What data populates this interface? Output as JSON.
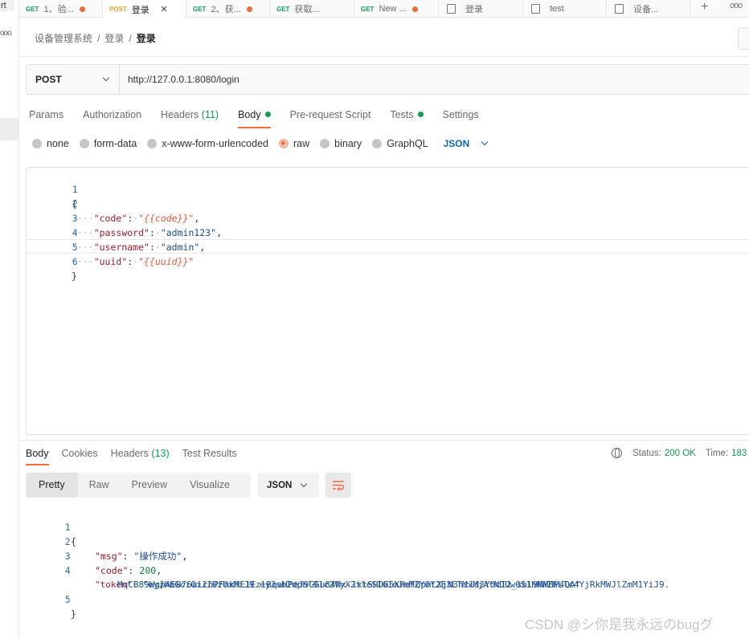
{
  "left_strip": {
    "fragment": "rt",
    "more": "ooo"
  },
  "tabs": [
    {
      "method": "GET",
      "label": "1、验...",
      "dot": true
    },
    {
      "method": "POST",
      "label": "登录",
      "close": "×"
    },
    {
      "method": "GET",
      "label": "2、获...",
      "dot": true
    },
    {
      "method": "GET",
      "label": "获取..."
    },
    {
      "method": "GET",
      "label": "New ...",
      "dot": true
    },
    {
      "label": "登录"
    },
    {
      "label": "test"
    },
    {
      "label": "设备..."
    }
  ],
  "tabbar": {
    "plus": "+",
    "more": "ooo"
  },
  "breadcrumb": {
    "collection": "设备管理系统",
    "folder": "登录",
    "current": "登录",
    "sep": "/"
  },
  "request": {
    "method": "POST",
    "url": "http://127.0.0.1:8080/login"
  },
  "request_tabs": [
    {
      "label": "Params"
    },
    {
      "label": "Authorization"
    },
    {
      "label": "Headers",
      "count": "(11)"
    },
    {
      "label": "Body",
      "active": true,
      "dot": true
    },
    {
      "label": "Pre-request Script"
    },
    {
      "label": "Tests",
      "dot": true
    },
    {
      "label": "Settings"
    }
  ],
  "body_types": [
    "none",
    "form-data",
    "x-www-form-urlencoded",
    "raw",
    "binary",
    "GraphQL"
  ],
  "body_type_selected": "raw",
  "raw_language": "JSON",
  "request_body": {
    "line_numbers": [
      "1",
      "2",
      "3",
      "4",
      "5",
      "6"
    ],
    "open": "{",
    "close": "}",
    "entries": [
      {
        "key": "\"code\"",
        "value": "\"{{code}}\"",
        "sep": ",",
        "template": true
      },
      {
        "key": "\"password\"",
        "value": "\"admin123\"",
        "sep": ",",
        "template": false
      },
      {
        "key": "\"username\"",
        "value": "\"admin\"",
        "sep": ",",
        "template": false
      },
      {
        "key": "\"uuid\"",
        "value": "\"{{uuid}}\"",
        "sep": "",
        "template": true
      }
    ]
  },
  "response_tabs": [
    {
      "label": "Body",
      "active": true
    },
    {
      "label": "Cookies"
    },
    {
      "label": "Headers",
      "count": "(13)"
    },
    {
      "label": "Test Results"
    }
  ],
  "status": {
    "label": "Status:",
    "value": "200 OK",
    "time_label": "Time:",
    "time_value": "183"
  },
  "view_modes": [
    "Pretty",
    "Raw",
    "Preview",
    "Visualize"
  ],
  "view_mode_selected": "Pretty",
  "response_format": "JSON",
  "response_body": {
    "line_numbers": [
      "1",
      "2",
      "3",
      "4",
      "5"
    ],
    "open": "{",
    "close": "}",
    "msg_key": "\"msg\"",
    "msg_value": "\"操作成功\"",
    "code_key": "\"code\"",
    "code_value": "200",
    "token_key": "\"token\"",
    "token_line1": "\"eyJhbGciOiJIUzUxMiJ9.eyJsb2dpbl91c2VyX2tleSI6ImJmM2Y0Y2E3LTMxMjAtNDUwOS1hNWZhLTc4YjRkMWJlZmM1YiJ9.",
    "token_line2": "MqCB89WgpAEB76uicnPFhkHE1EzlBqaHPeJ9GGu84Nx-1xtSHD85XHeFQpnLXjN3hz1dJY0cI2_sbl9MMHP4QA\""
  },
  "watermark": "CSDN @シ你是我永远のbugグ",
  "colors": {
    "accent": "#f26b3a",
    "success": "#0f9d58",
    "link": "#0b65c2",
    "post": "#e8a52d"
  }
}
